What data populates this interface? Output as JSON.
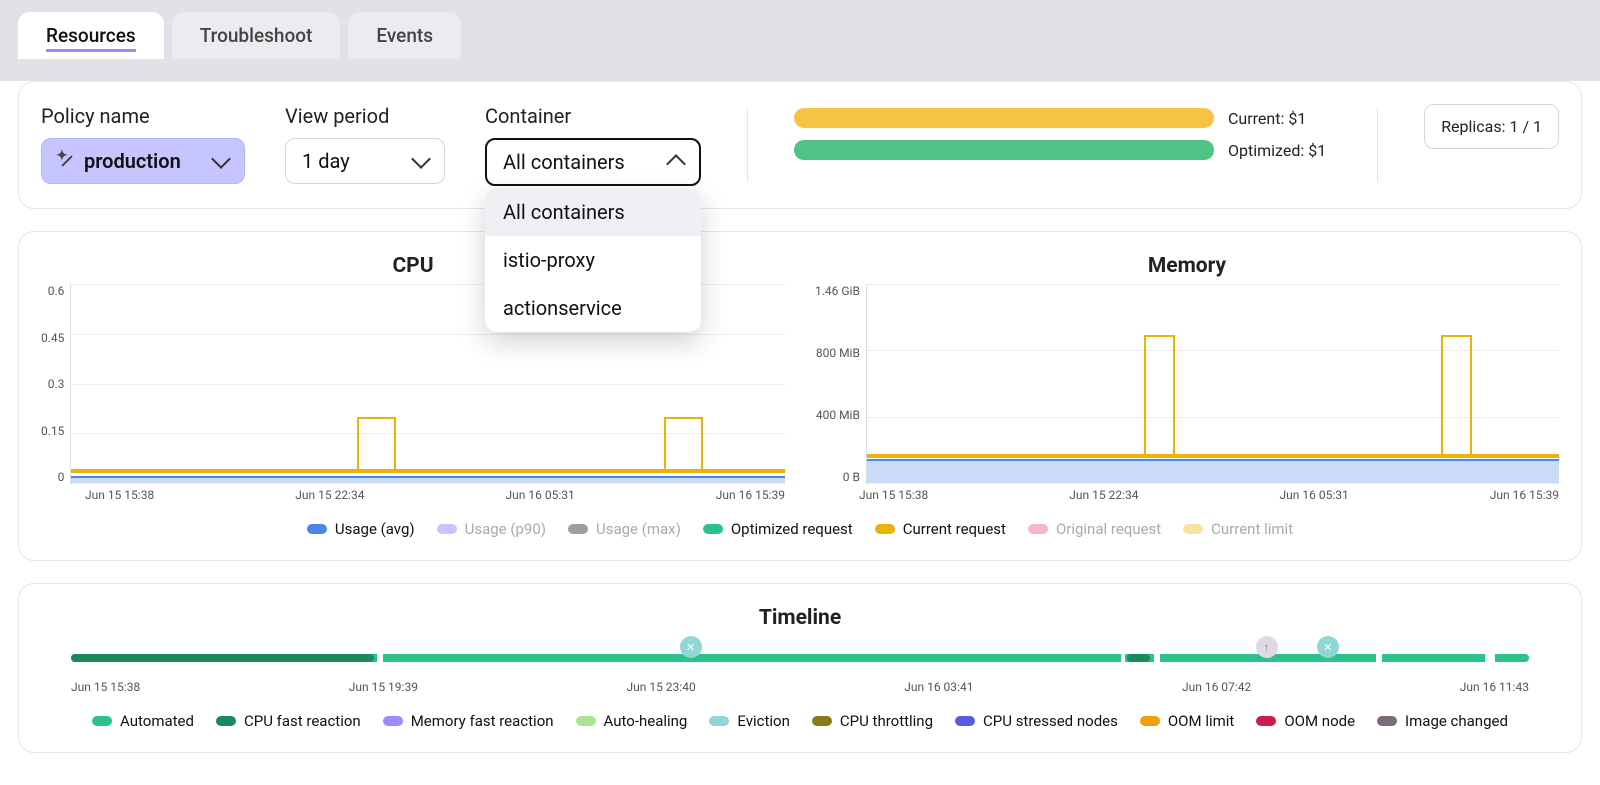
{
  "tabs": [
    "Resources",
    "Troubleshoot",
    "Events"
  ],
  "active_tab": 0,
  "filters": {
    "policy_label": "Policy name",
    "policy_value": "production",
    "period_label": "View period",
    "period_value": "1 day",
    "container_label": "Container",
    "container_value": "All containers",
    "container_options": [
      "All containers",
      "istio-proxy",
      "actionservice"
    ]
  },
  "costs": {
    "current_label": "Current: $1",
    "optimized_label": "Optimized: $1"
  },
  "replicas_label": "Replicas: 1 / 1",
  "chart_data": [
    {
      "type": "line",
      "title": "CPU",
      "ylabel": "",
      "ylim": [
        0,
        0.6
      ],
      "y_ticks": [
        "0.6",
        "0.45",
        "0.3",
        "0.15",
        "0"
      ],
      "x_ticks": [
        "Jun 15 15:38",
        "Jun 15 22:34",
        "Jun 16 05:31",
        "Jun 16 15:39"
      ],
      "series": [
        {
          "name": "Usage (avg)",
          "approx_constant": 0.02,
          "color": "#4a86e8"
        },
        {
          "name": "Optimized request",
          "approx_constant": 0.03,
          "color": "#2cc38a"
        },
        {
          "name": "Current request",
          "baseline": 0.03,
          "spikes": [
            {
              "start_frac": 0.4,
              "end_frac": 0.455,
              "value": 0.2
            },
            {
              "start_frac": 0.83,
              "end_frac": 0.885,
              "value": 0.2
            }
          ],
          "color": "#eab308"
        }
      ]
    },
    {
      "type": "line",
      "title": "Memory",
      "ylabel": "",
      "ylim_bytes": [
        0,
        1570000000
      ],
      "y_ticks": [
        "1.46 GiB",
        "800 MiB",
        "400 MiB",
        "0 B"
      ],
      "x_ticks": [
        "Jun 15 15:38",
        "Jun 15 22:34",
        "Jun 16 05:31",
        "Jun 16 15:39"
      ],
      "series": [
        {
          "name": "Usage (avg)",
          "approx_constant_mib": 190,
          "color": "#4a86e8"
        },
        {
          "name": "Optimized request",
          "approx_constant_mib": 200,
          "color": "#2cc38a"
        },
        {
          "name": "Current request",
          "baseline_mib": 200,
          "spikes": [
            {
              "start_frac": 0.4,
              "end_frac": 0.445,
              "value_mib": 1170
            },
            {
              "start_frac": 0.83,
              "end_frac": 0.875,
              "value_mib": 1170
            }
          ],
          "color": "#eab308"
        }
      ]
    }
  ],
  "chart_legend": [
    {
      "label": "Usage (avg)",
      "color": "#4a86e8",
      "muted": false
    },
    {
      "label": "Usage (p90)",
      "color": "#c7c5ff",
      "muted": true
    },
    {
      "label": "Usage (max)",
      "color": "#9aa0a6",
      "muted": true
    },
    {
      "label": "Optimized request",
      "color": "#2cc38a",
      "muted": false
    },
    {
      "label": "Current request",
      "color": "#eab308",
      "muted": false
    },
    {
      "label": "Original request",
      "color": "#f7b6c8",
      "muted": true
    },
    {
      "label": "Current limit",
      "color": "#f6e3a0",
      "muted": true
    }
  ],
  "timeline": {
    "title": "Timeline",
    "x_ticks": [
      "Jun 15 15:38",
      "Jun 15 19:39",
      "Jun 15 23:40",
      "Jun 16 03:41",
      "Jun 16 07:42",
      "Jun 16 11:43"
    ],
    "markers": [
      {
        "kind": "eviction",
        "pos_frac": 0.425
      },
      {
        "kind": "up",
        "pos_frac": 0.82
      },
      {
        "kind": "eviction",
        "pos_frac": 0.862
      }
    ],
    "dark_segments": [
      {
        "start_frac": 0.0,
        "end_frac": 0.208
      },
      {
        "start_frac": 0.724,
        "end_frac": 0.74
      }
    ],
    "gaps": [
      {
        "pos_frac": 0.21,
        "w": 6
      },
      {
        "pos_frac": 0.72,
        "w": 4
      },
      {
        "pos_frac": 0.743,
        "w": 6
      },
      {
        "pos_frac": 0.895,
        "w": 6
      },
      {
        "pos_frac": 0.97,
        "w": 10
      }
    ],
    "legend": [
      {
        "label": "Automated",
        "color": "#2cc38a"
      },
      {
        "label": "CPU fast reaction",
        "color": "#1a8a5e"
      },
      {
        "label": "Memory fast reaction",
        "color": "#9a8cff"
      },
      {
        "label": "Auto-healing",
        "color": "#a9e58f"
      },
      {
        "label": "Eviction",
        "color": "#8fd7d5"
      },
      {
        "label": "CPU throttling",
        "color": "#8a7a1a"
      },
      {
        "label": "CPU stressed nodes",
        "color": "#5a5ae0"
      },
      {
        "label": "OOM limit",
        "color": "#f59e0b"
      },
      {
        "label": "OOM node",
        "color": "#c81e4a"
      },
      {
        "label": "Image changed",
        "color": "#7a6a7a"
      }
    ]
  }
}
